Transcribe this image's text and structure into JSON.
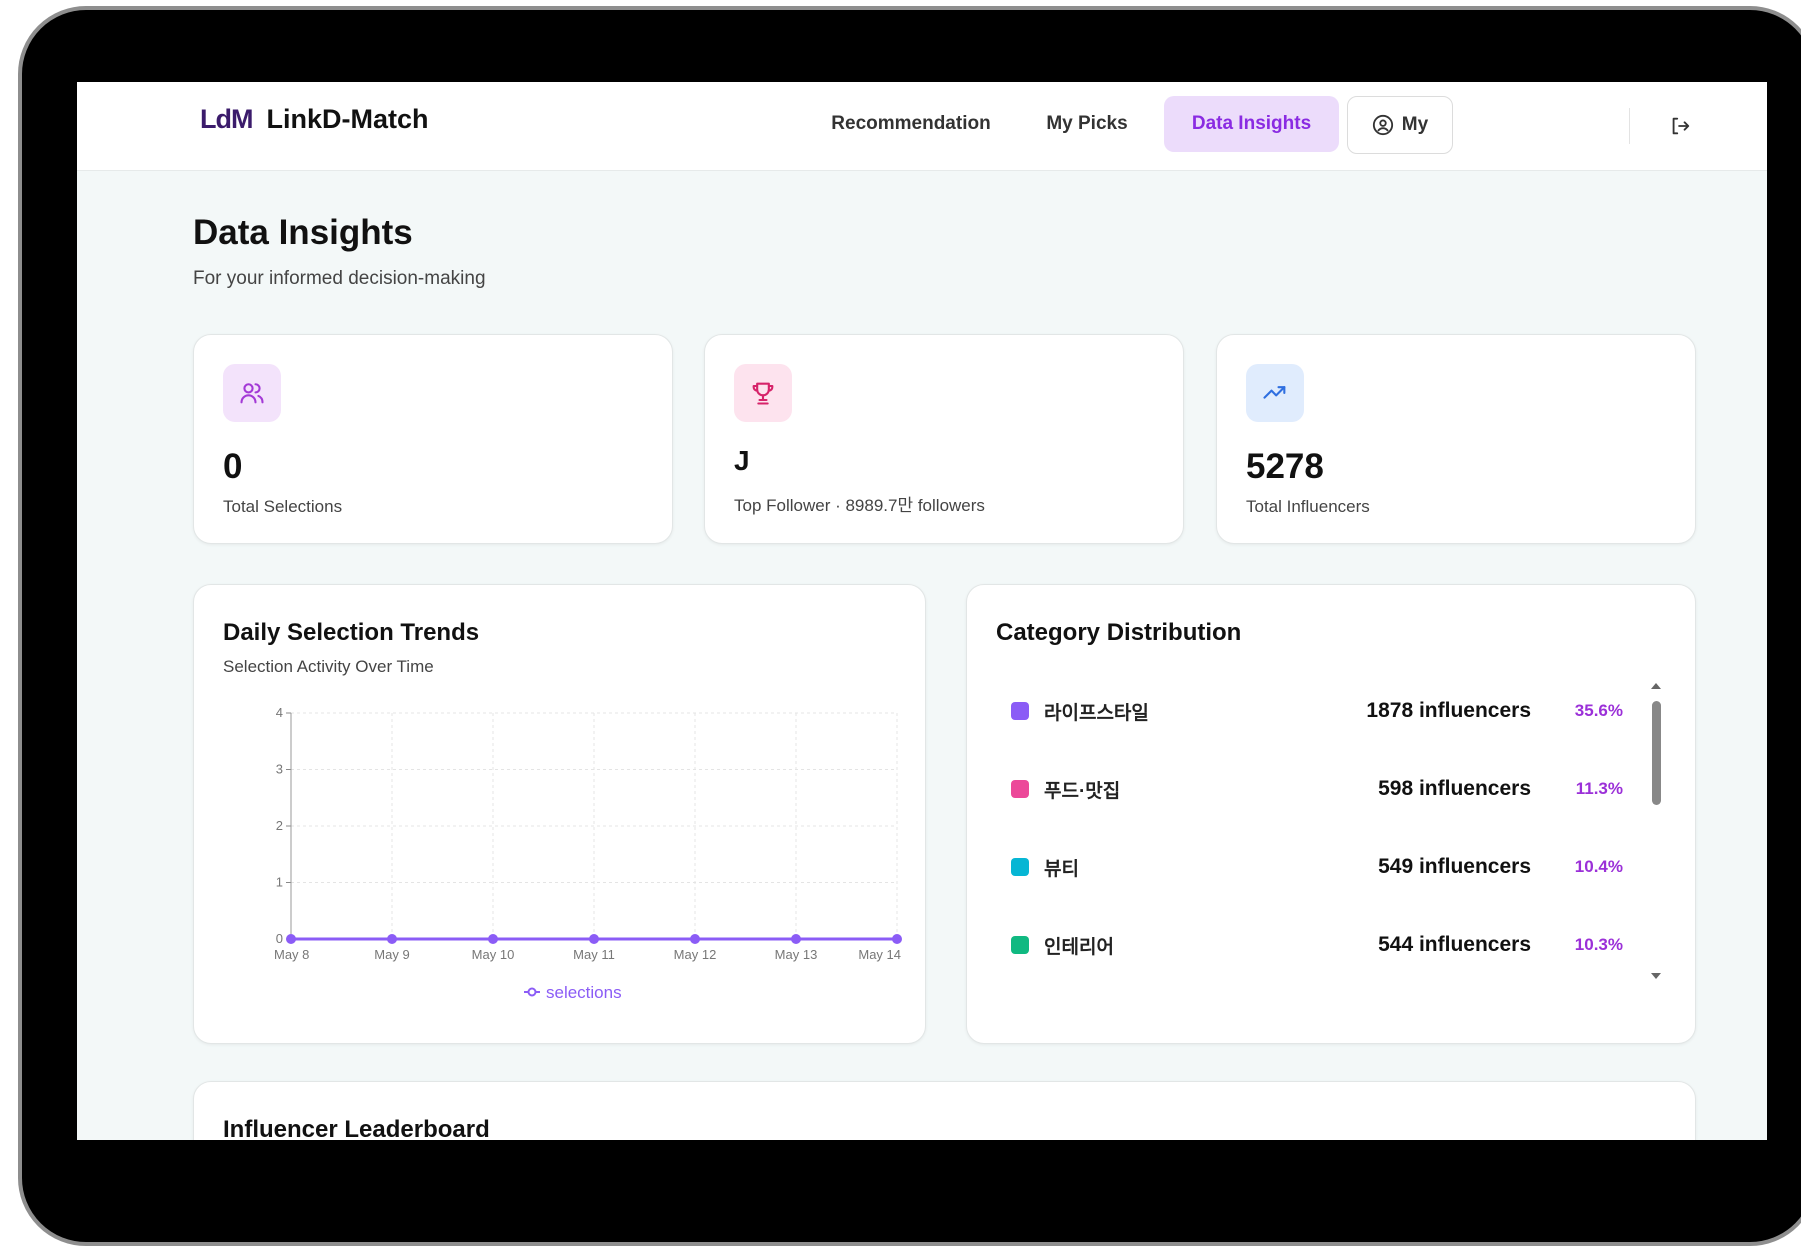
{
  "header": {
    "logo_text": "LdM",
    "brand": "LinkD-Match",
    "nav": {
      "recommendation": "Recommendation",
      "my_picks": "My Picks",
      "data_insights": "Data Insights",
      "my": "My"
    },
    "active_tab": "Data Insights"
  },
  "page": {
    "title": "Data Insights",
    "subtitle": "For your informed decision-making"
  },
  "stats": [
    {
      "value": "0",
      "label": "Total Selections",
      "icon": "users-icon"
    },
    {
      "value": "J",
      "label": "Top Follower · 8989.7만 followers",
      "icon": "trophy-icon"
    },
    {
      "value": "5278",
      "label": "Total Influencers",
      "icon": "trending-up-icon"
    }
  ],
  "trends": {
    "title": "Daily Selection Trends",
    "subtitle": "Selection Activity Over Time"
  },
  "chart_data": {
    "type": "line",
    "x": [
      "May 8",
      "May 9",
      "May 10",
      "May 11",
      "May 12",
      "May 13",
      "May 14"
    ],
    "series": [
      {
        "name": "selections",
        "values": [
          0,
          0,
          0,
          0,
          0,
          0,
          0
        ]
      }
    ],
    "yticks": [
      "0",
      "1",
      "2",
      "3",
      "4"
    ],
    "ylim": [
      0,
      4
    ],
    "grid": true,
    "legend": "bottom",
    "color": "#8b5cf6"
  },
  "categories": {
    "title": "Category Distribution",
    "items": [
      {
        "name": "라이프스타일",
        "count": "1878 influencers",
        "pct": "35.6%",
        "color": "#8b5cf6"
      },
      {
        "name": "푸드·맛집",
        "count": "598 influencers",
        "pct": "11.3%",
        "color": "#ec4899"
      },
      {
        "name": "뷰티",
        "count": "549 influencers",
        "pct": "10.4%",
        "color": "#06b6d4"
      },
      {
        "name": "인테리어",
        "count": "544 influencers",
        "pct": "10.3%",
        "color": "#10b981"
      }
    ]
  },
  "leaderboard": {
    "title": "Influencer Leaderboard"
  }
}
